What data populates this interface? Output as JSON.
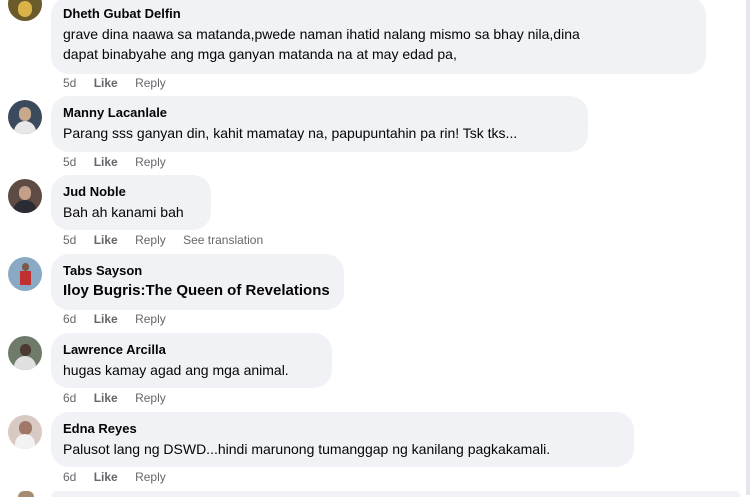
{
  "comments": [
    {
      "author": "Dheth Gubat Delfin",
      "lines": [
        "grave dina naawa sa matanda,pwede naman ihatid nalang mismo sa bhay nila,dina",
        "dapat binabyahe ang mga ganyan matanda na at may edad pa,"
      ],
      "time": "5d",
      "like": "Like",
      "reply": "Reply",
      "avatar_color": "#6b5a2a"
    },
    {
      "author": "Manny Lacanlale",
      "lines": [
        "Parang sss ganyan din, kahit mamatay na, papupuntahin pa rin! Tsk tks..."
      ],
      "time": "5d",
      "like": "Like",
      "reply": "Reply",
      "avatar_color": "#3c4a5e"
    },
    {
      "author": "Jud Noble",
      "lines": [
        "Bah ah kanami bah"
      ],
      "time": "5d",
      "like": "Like",
      "reply": "Reply",
      "translate": "See translation",
      "avatar_color": "#5e4b43"
    },
    {
      "author": "Tabs Sayson",
      "lines": [
        "Iloу Bugris:The Queen of Revelations"
      ],
      "time": "6d",
      "like": "Like",
      "reply": "Reply",
      "avatar_color": "#8aa9c4"
    },
    {
      "author": "Lawrence Arcilla",
      "lines": [
        "hugas kamay agad ang mga animal."
      ],
      "time": "6d",
      "like": "Like",
      "reply": "Reply",
      "avatar_color": "#6e7a6a"
    },
    {
      "author": "Edna Reyes",
      "lines": [
        "Palusot lang ng DSWD...hindi marunong tumanggap ng kanilang pagkakamali."
      ],
      "time": "6d",
      "like": "Like",
      "reply": "Reply",
      "avatar_color": "#d8c9c2"
    }
  ]
}
